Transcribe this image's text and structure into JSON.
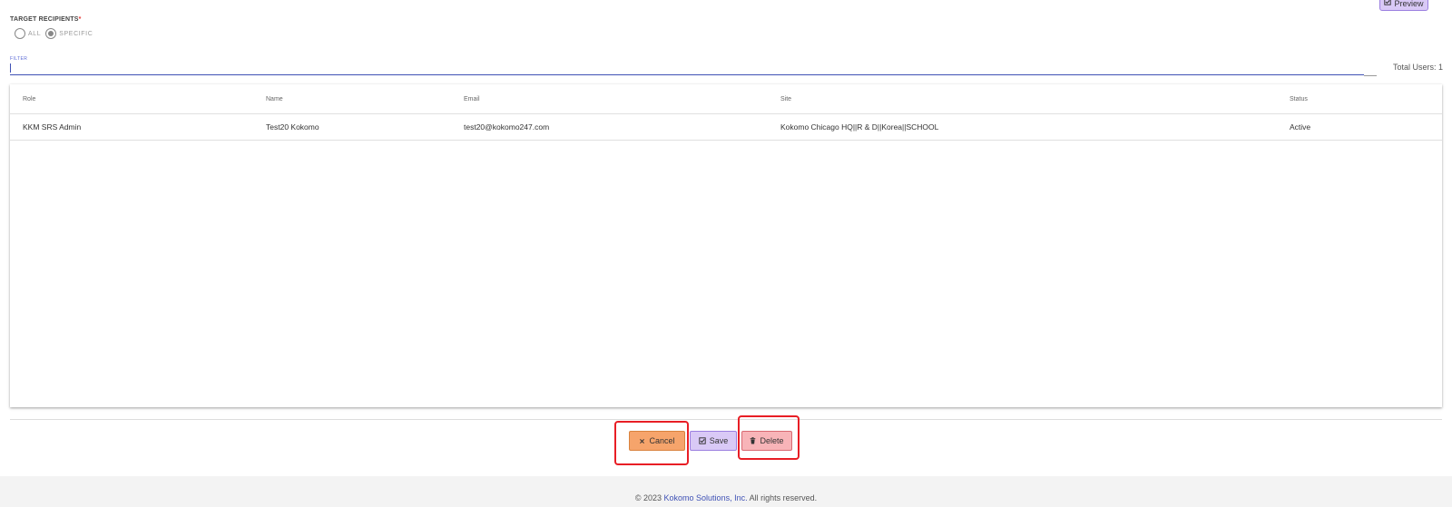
{
  "header": {
    "preview_label": "Preview"
  },
  "recipients": {
    "label": "TARGET RECIPIENTS",
    "required_mark": "*",
    "options": [
      {
        "label": "ALL",
        "selected": false
      },
      {
        "label": "SPECIFIC",
        "selected": true
      }
    ]
  },
  "filter": {
    "label": "FILTER",
    "value": ""
  },
  "total_users": "Total Users: 1",
  "table": {
    "columns": [
      "Role",
      "Name",
      "Email",
      "Site",
      "Status"
    ],
    "rows": [
      {
        "role": "KKM SRS Admin",
        "name": "Test20 Kokomo",
        "email": "test20@kokomo247.com",
        "site": "Kokomo Chicago HQ||R & D||Korea||SCHOOL",
        "status": "Active"
      }
    ]
  },
  "actions": {
    "cancel_label": "Cancel",
    "save_label": "Save",
    "delete_label": "Delete"
  },
  "footer": {
    "prefix": "© 2023 ",
    "brand": "Kokomo Solutions, Inc.",
    "suffix": " All rights reserved."
  },
  "colors": {
    "accent": "#3f51b5",
    "cancel_bg": "#f6a46b",
    "save_bg": "#d9c9f6",
    "delete_bg": "#f8b4b8",
    "highlight": "#e81e25"
  }
}
